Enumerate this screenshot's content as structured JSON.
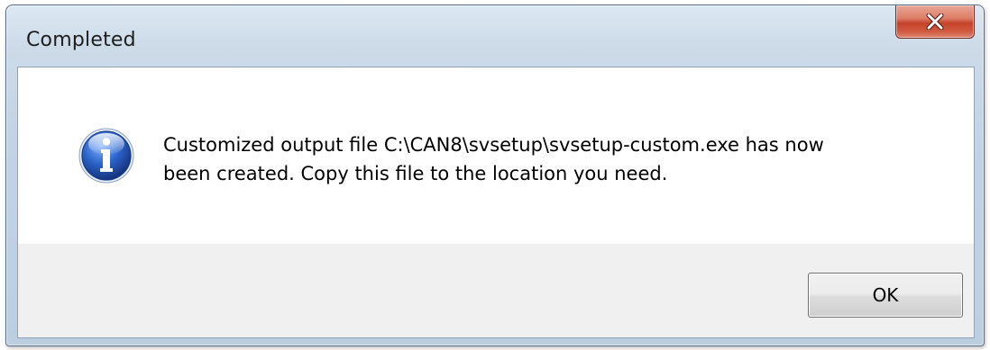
{
  "dialog": {
    "title": "Completed",
    "close_label": "X",
    "icon": "information-icon",
    "message_line1": "Customized output file C:\\CAN8\\svsetup\\svsetup-custom.exe has now",
    "message_line2": "been created. Copy this file to the location you need.",
    "ok_label": "OK"
  },
  "colors": {
    "close_button": "#c4432a",
    "info_icon": "#2a62c9",
    "frame": "#c3d3e3"
  }
}
